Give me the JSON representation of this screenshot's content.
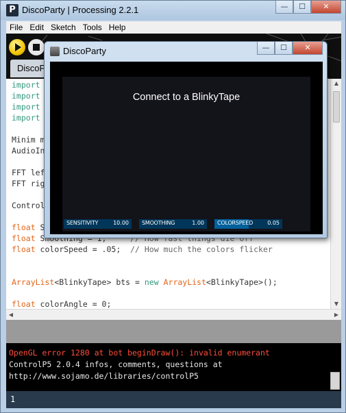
{
  "main_window": {
    "app_icon": "P",
    "title": "DiscoParty | Processing 2.2.1",
    "controls": {
      "minimize": "—",
      "maximize": "☐",
      "close": "✕"
    }
  },
  "menu": [
    "File",
    "Edit",
    "Sketch",
    "Tools",
    "Help"
  ],
  "toolbar": {
    "tab_label": "DiscoPa"
  },
  "editor": {
    "lines": [
      {
        "segments": [
          {
            "text": "import",
            "cls": "kw-teal"
          }
        ]
      },
      {
        "segments": [
          {
            "text": "import",
            "cls": "kw-teal"
          }
        ]
      },
      {
        "segments": [
          {
            "text": "import",
            "cls": "kw-teal"
          }
        ]
      },
      {
        "segments": [
          {
            "text": "import",
            "cls": "kw-teal"
          }
        ]
      },
      {
        "segments": [
          {
            "text": "",
            "cls": ""
          }
        ]
      },
      {
        "segments": [
          {
            "text": "Minim m",
            "cls": ""
          }
        ]
      },
      {
        "segments": [
          {
            "text": "AudioIn",
            "cls": ""
          }
        ]
      },
      {
        "segments": [
          {
            "text": "",
            "cls": ""
          }
        ]
      },
      {
        "segments": [
          {
            "text": "FFT lef",
            "cls": ""
          }
        ]
      },
      {
        "segments": [
          {
            "text": "FFT rig",
            "cls": ""
          }
        ]
      },
      {
        "segments": [
          {
            "text": "",
            "cls": ""
          }
        ]
      },
      {
        "segments": [
          {
            "text": "Control",
            "cls": ""
          }
        ]
      },
      {
        "segments": [
          {
            "text": "",
            "cls": ""
          }
        ]
      },
      {
        "segments": [
          {
            "text": "float",
            "cls": "kw-type"
          },
          {
            "text": " S",
            "cls": ""
          }
        ]
      },
      {
        "segments": [
          {
            "text": "float",
            "cls": "kw-type"
          },
          {
            "text": " Smoothing = 1;",
            "cls": ""
          },
          {
            "text": "     // How fast things die off",
            "cls": "cmt"
          }
        ]
      },
      {
        "segments": [
          {
            "text": "float",
            "cls": "kw-type"
          },
          {
            "text": " colorSpeed = .05;",
            "cls": ""
          },
          {
            "text": "  // How much the colors flicker",
            "cls": "cmt"
          }
        ]
      },
      {
        "segments": [
          {
            "text": "",
            "cls": ""
          }
        ]
      },
      {
        "segments": [
          {
            "text": "",
            "cls": ""
          }
        ]
      },
      {
        "segments": [
          {
            "text": "ArrayList",
            "cls": "kw-type"
          },
          {
            "text": "<BlinkyTape> bts = ",
            "cls": ""
          },
          {
            "text": "new",
            "cls": "kw-teal"
          },
          {
            "text": " ",
            "cls": ""
          },
          {
            "text": "ArrayList",
            "cls": "kw-type"
          },
          {
            "text": "<BlinkyTape>();",
            "cls": ""
          }
        ]
      },
      {
        "segments": [
          {
            "text": "",
            "cls": ""
          }
        ]
      },
      {
        "segments": [
          {
            "text": "float",
            "cls": "kw-type"
          },
          {
            "text": " colorAngle = 0;",
            "cls": ""
          }
        ]
      }
    ],
    "scroll_up": "▲",
    "scroll_down": "▼",
    "scroll_left": "◀",
    "scroll_right": "▶"
  },
  "console": {
    "lines": [
      {
        "text": "OpenGL error 1280 at bot beginDraw(): invalid enumerant",
        "color": "#ff4d3a"
      },
      {
        "text": "ControlP5 2.0.4 infos, comments, questions at",
        "color": "#e8e8e8"
      },
      {
        "text": "http://www.sojamo.de/libraries/controlP5",
        "color": "#e8e8e8"
      }
    ]
  },
  "status": {
    "line_number": "1"
  },
  "sketch_window": {
    "title": "DiscoParty",
    "controls": {
      "minimize": "—",
      "maximize": "☐",
      "close": "✕"
    },
    "connect_text": "Connect to a BlinkyTape",
    "sliders": [
      {
        "label": "SENSITIVITY",
        "value": "10.00",
        "fill_fraction": 0.0
      },
      {
        "label": "SMOOTHING",
        "value": "1.00",
        "fill_fraction": 0.0
      },
      {
        "label": "COLORSPEED",
        "value": "0.05",
        "fill_fraction": 0.5
      }
    ]
  },
  "colors": {
    "slider_bg": "#00365a",
    "slider_fill": "#00609c",
    "console_error": "#ff4d3a",
    "status_bar": "#283a4c"
  }
}
